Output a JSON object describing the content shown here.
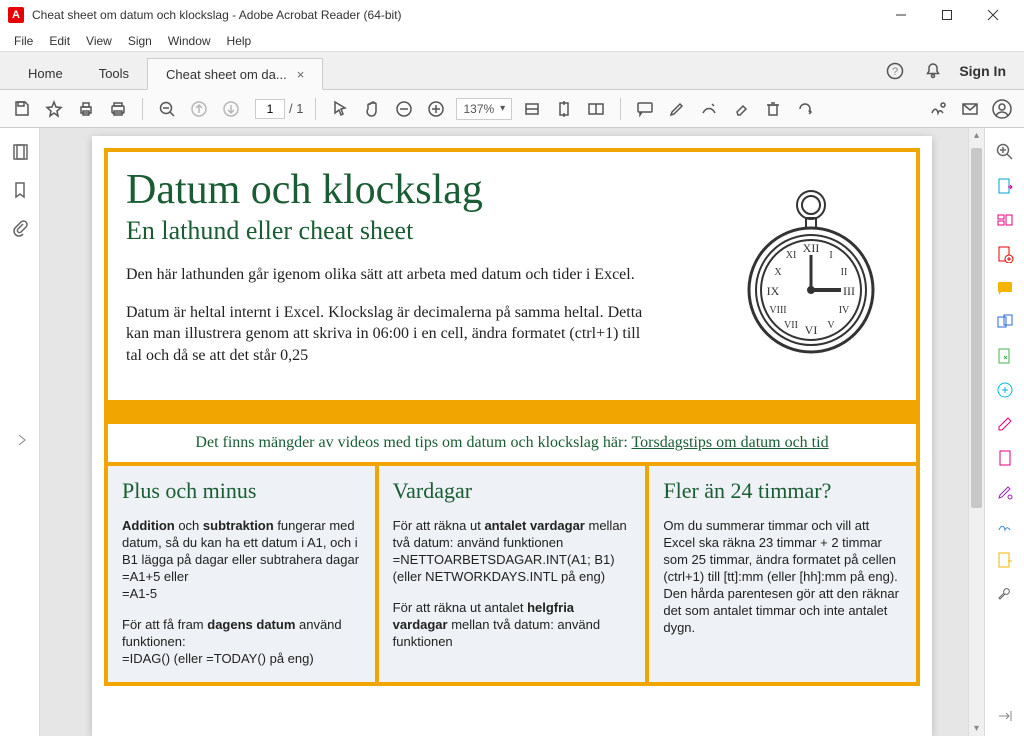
{
  "window": {
    "title": "Cheat sheet om datum och klockslag - Adobe Acrobat Reader (64-bit)",
    "app_icon_letter": "A"
  },
  "menu": {
    "file": "File",
    "edit": "Edit",
    "view": "View",
    "sign": "Sign",
    "window": "Window",
    "help": "Help"
  },
  "tabs": {
    "home": "Home",
    "tools": "Tools",
    "doc": "Cheat sheet om da...",
    "signin": "Sign In"
  },
  "toolbar": {
    "page_current": "1",
    "page_total": "/ 1",
    "zoom": "137%"
  },
  "doc": {
    "title": "Datum och klockslag",
    "subtitle": "En lathund eller cheat sheet",
    "intro1": "Den här lathunden går igenom olika sätt att arbeta med datum och tider i Excel.",
    "intro2": "Datum är heltal internt i Excel. Klockslag är decimalerna på samma heltal. Detta kan man illustrera genom att skriva in 06:00 i en cell, ändra formatet (ctrl+1) till tal och då se att det står 0,25",
    "banner_text": "Det finns mängder av videos med tips om datum och klockslag här: ",
    "banner_link": "Torsdagstips om datum och tid",
    "cols": {
      "c1": {
        "h": "Plus och minus",
        "p1a": "Addition",
        "p1b": " och ",
        "p1c": "subtraktion",
        "p1d": " fungerar med datum, så du kan ha ett datum i A1, och i B1 lägga på dagar eller subtrahera dagar",
        "p1e": "=A1+5 eller",
        "p1f": "=A1-5",
        "p2a": "För att få fram ",
        "p2b": "dagens datum",
        "p2c": " använd funktionen:",
        "p2d": "=IDAG() (eller =TODAY() på eng)"
      },
      "c2": {
        "h": "Vardagar",
        "p1a": "För att räkna ut ",
        "p1b": "antalet vardagar",
        "p1c": " mellan två datum: använd funktionen",
        "p1d": "=NETTOARBETSDAGAR.INT(A1; B1) (eller NETWORKDAYS.INTL på eng)",
        "p2a": "För att räkna ut antalet ",
        "p2b": "helgfria vardagar",
        "p2c": " mellan två datum: använd funktionen"
      },
      "c3": {
        "h": "Fler än 24 timmar?",
        "p1": "Om du summerar timmar och vill att Excel ska räkna 23 timmar + 2 timmar som 25 timmar, ändra formatet på cellen (ctrl+1) till [tt]:mm (eller [hh]:mm på eng). Den hårda parentesen gör att den räknar det som antalet timmar och inte antalet dygn."
      }
    }
  }
}
